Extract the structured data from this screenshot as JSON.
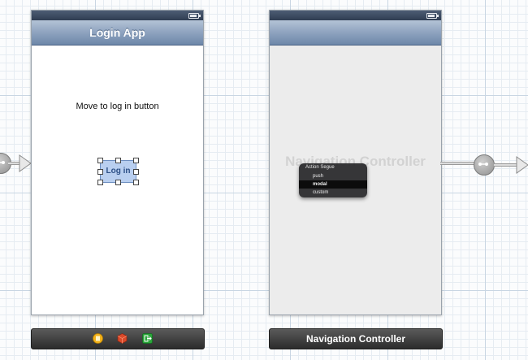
{
  "login_scene": {
    "nav_title": "Login App",
    "instruction": "Move to log in button",
    "button_label": "Log in"
  },
  "nav_scene": {
    "watermark": "Navigation Controller",
    "bottom_label": "Navigation Controller"
  },
  "segue_popup": {
    "title": "Action Segue",
    "items": [
      "push",
      "modal",
      "custom"
    ],
    "selected": "modal"
  },
  "dock_icons": [
    "first-responder-icon",
    "cube-object-icon",
    "exit-icon"
  ]
}
